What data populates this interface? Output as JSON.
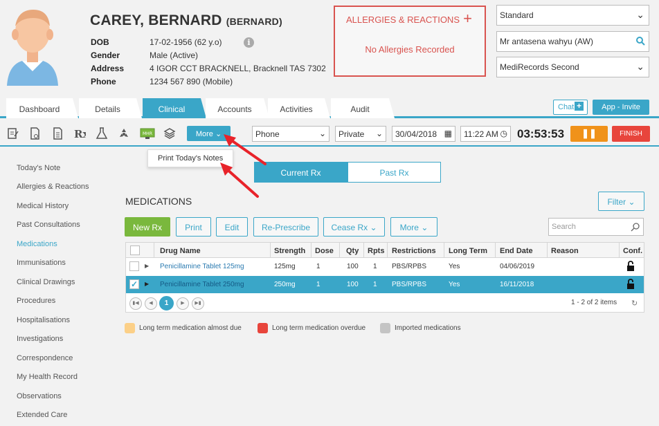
{
  "patient": {
    "name": "CAREY, BERNARD",
    "preferred": "(BERNARD)",
    "fields": [
      {
        "label": "DOB",
        "value": "17-02-1956 (62 y.o)"
      },
      {
        "label": "Gender",
        "value": "Male (Active)"
      },
      {
        "label": "Address",
        "value": "4 IGOR CCT BRACKNELL, Bracknell TAS 7302"
      },
      {
        "label": "Phone",
        "value": "1234 567 890 (Mobile)"
      }
    ]
  },
  "allergies": {
    "title": "ALLERGIES & REACTIONS",
    "message": "No Allergies Recorded"
  },
  "header_selects": {
    "template": "Standard",
    "doctor": "Mr antasena wahyu (AW)",
    "practice": "MediRecords Second"
  },
  "tabs": [
    "Dashboard",
    "Details",
    "Clinical",
    "Accounts",
    "Activities",
    "Audit"
  ],
  "active_tab": "Clinical",
  "top_buttons": {
    "chat": "Chat",
    "invite": "App - Invite"
  },
  "toolbar": {
    "more": "More",
    "contact_type": "Phone",
    "billing": "Private",
    "date": "30/04/2018",
    "time": "11:22 AM",
    "timer": "03:53:53",
    "finish": "FINISH"
  },
  "more_menu": {
    "item": "Print Today's Notes"
  },
  "sidebar": [
    "Today's Note",
    "Allergies & Reactions",
    "Medical History",
    "Past Consultations",
    "Medications",
    "Immunisations",
    "Clinical Drawings",
    "Procedures",
    "Hospitalisations",
    "Investigations",
    "Correspondence",
    "My Health Record",
    "Observations",
    "Extended Care"
  ],
  "sidebar_active": "Medications",
  "rx_toggle": {
    "current": "Current Rx",
    "past": "Past Rx"
  },
  "medications": {
    "title": "MEDICATIONS",
    "filter": "Filter",
    "buttons": {
      "new": "New Rx",
      "print": "Print",
      "edit": "Edit",
      "represcribe": "Re-Prescribe",
      "cease": "Cease Rx",
      "more": "More"
    },
    "search_placeholder": "Search",
    "columns": [
      "Drug Name",
      "Strength",
      "Dose",
      "Qty",
      "Rpts",
      "Restrictions",
      "Long Term",
      "End Date",
      "Reason",
      "Conf."
    ],
    "rows": [
      {
        "drug": "Penicillamine Tablet 125mg",
        "strength": "125mg",
        "dose": "1",
        "qty": "100",
        "rpts": "1",
        "restrictions": "PBS/RPBS",
        "long_term": "Yes",
        "end_date": "04/06/2019",
        "reason": "",
        "selected": false
      },
      {
        "drug": "Penicillamine Tablet 250mg",
        "strength": "250mg",
        "dose": "1",
        "qty": "100",
        "rpts": "1",
        "restrictions": "PBS/RPBS",
        "long_term": "Yes",
        "end_date": "16/11/2018",
        "reason": "",
        "selected": true
      }
    ],
    "page": "1",
    "items_text": "1 - 2 of 2 items"
  },
  "legend": [
    {
      "label": "Long term medication almost due",
      "color": "#fcd088"
    },
    {
      "label": "Long term medication overdue",
      "color": "#e8453c"
    },
    {
      "label": "Imported medications",
      "color": "#c4c4c4"
    }
  ],
  "colors": {
    "accent": "#3aa6c8",
    "alert": "#d9534f",
    "new_rx": "#7ab83d",
    "pause": "#f0921a",
    "finish": "#e8453c"
  }
}
